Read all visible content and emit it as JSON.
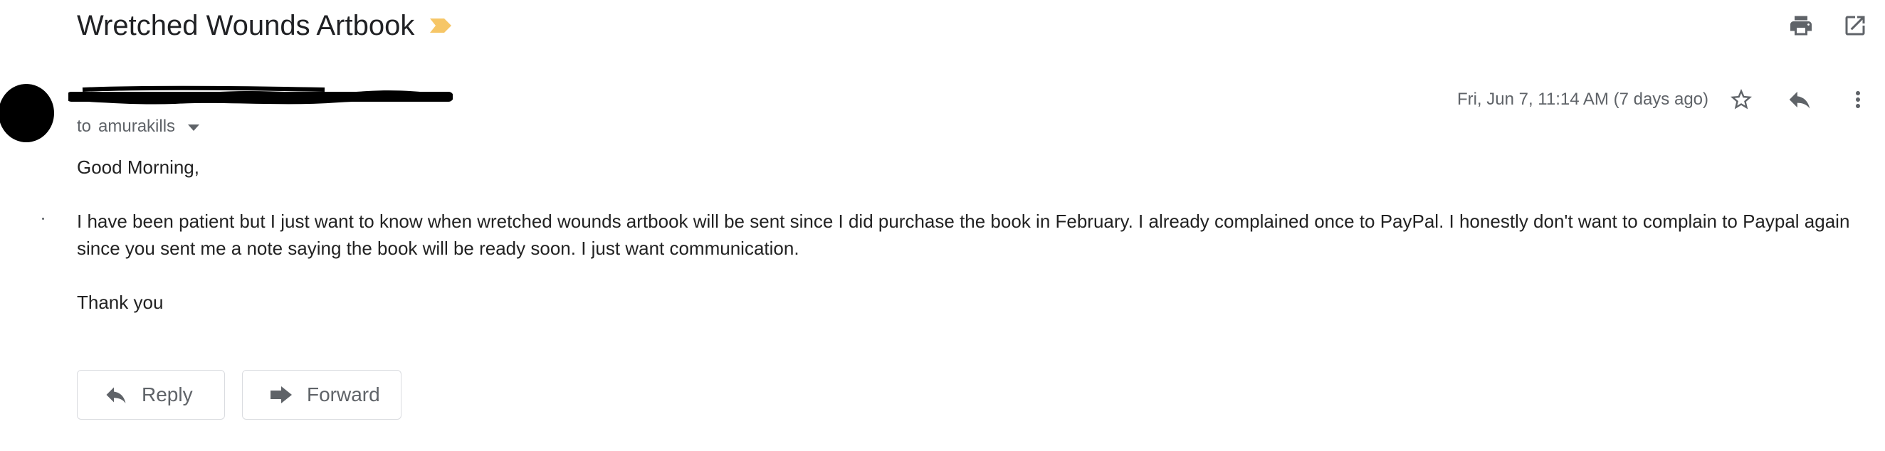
{
  "message": {
    "subject": "Wretched Wounds Artbook",
    "recipient_prefix": "to",
    "recipient": "amurakills",
    "date": "Fri, Jun 7, 11:14 AM (7 days ago)",
    "body": {
      "greeting": "Good Morning,",
      "line1": "I have been patient but I just want to know when wretched wounds artbook will be sent since I did purchase the book in February. I already complained once to PayPal. I honestly don't want to complain to Paypal again",
      "line2": "since you sent me a note saying the book will be ready soon. I just want communication.",
      "closing": "Thank you"
    }
  },
  "actions": {
    "reply_label": "Reply",
    "forward_label": "Forward"
  },
  "icons": {
    "importance": "importance-marker-icon",
    "print": "print-icon",
    "open_new_window": "open-in-new-window-icon",
    "star": "star-icon",
    "reply": "reply-icon",
    "more": "more-vert-icon",
    "forward": "forward-icon"
  },
  "colors": {
    "importance_marker": "#f6c667",
    "icon_gray": "#5f6368",
    "text_dark": "#202124",
    "border": "#dadce0"
  }
}
